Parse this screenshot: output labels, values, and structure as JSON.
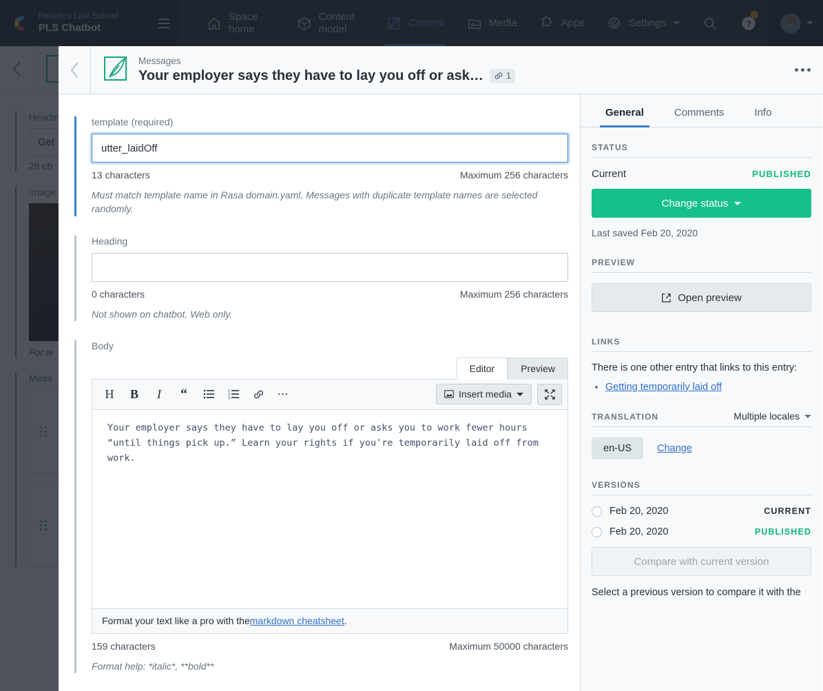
{
  "topnav": {
    "org": "People's Law School",
    "space": "PLS Chatbot",
    "menu_icon": "hamburger-icon",
    "items": [
      {
        "label": "Space home",
        "icon": "home-icon",
        "active": false
      },
      {
        "label": "Content model",
        "icon": "cube-icon",
        "active": false
      },
      {
        "label": "Content",
        "icon": "quill-icon",
        "active": true
      },
      {
        "label": "Media",
        "icon": "media-icon",
        "active": false
      },
      {
        "label": "Apps",
        "icon": "puzzle-icon",
        "active": false
      },
      {
        "label": "Settings",
        "icon": "gear-icon",
        "active": false
      }
    ],
    "search_icon": "search-icon",
    "help_icon": "help-icon",
    "avatar": "avatar"
  },
  "background": {
    "fields": [
      {
        "label": "Heading",
        "value": "Get",
        "count": "28 ch"
      },
      {
        "label": "Image"
      },
      {
        "label": "Mess"
      }
    ],
    "caption": "For w"
  },
  "modal": {
    "back_icon": "chevron-left-icon",
    "entry_icon": "quill-entry-icon",
    "content_type": "Messages",
    "title": "Your employer says they have to lay you off or ask…",
    "link_badge_icon": "link-icon",
    "link_badge_count": "1",
    "more_icon": "ellipsis-icon"
  },
  "editor": {
    "template_field": {
      "label": "template (required)",
      "value": "utter_laidOff",
      "count": "13 characters",
      "max": "Maximum 256 characters",
      "help": "Must match template name in Rasa domain.yaml. Messages with duplicate template names are selected randomly.",
      "focused": true
    },
    "heading_field": {
      "label": "Heading",
      "value": "",
      "placeholder": "",
      "count": "0 characters",
      "max": "Maximum 256 characters",
      "help": "Not shown on chatbot. Web only."
    },
    "body_field": {
      "label": "Body",
      "tabs": [
        {
          "label": "Editor",
          "active": true
        },
        {
          "label": "Preview",
          "active": false
        }
      ],
      "toolbar": [
        {
          "name": "heading-button",
          "glyph": "H"
        },
        {
          "name": "bold-button",
          "glyph": "B"
        },
        {
          "name": "italic-button",
          "glyph": "I"
        },
        {
          "name": "quote-button",
          "glyph": "“"
        },
        {
          "name": "unordered-list-button",
          "glyph": "☰"
        },
        {
          "name": "ordered-list-button",
          "glyph": "☷"
        },
        {
          "name": "link-button",
          "glyph": "⚭"
        },
        {
          "name": "more-options-button",
          "glyph": "⋯"
        }
      ],
      "insert_media_label": "Insert media",
      "insert_media_icon": "image-icon",
      "expand_icon": "expand-icon",
      "value": "Your employer says they have to lay you off or asks you to work fewer hours “until things pick up.” Learn your rights if you're temporarily laid off from work.",
      "footer_prefix": "Format your text like a pro with the ",
      "footer_link": "markdown cheatsheet",
      "footer_suffix": ".",
      "count": "159 characters",
      "max": "Maximum 50000 characters",
      "help": "Format help: *italic*, **bold**"
    }
  },
  "sidebar": {
    "tabs": [
      {
        "label": "General",
        "active": true
      },
      {
        "label": "Comments",
        "active": false
      },
      {
        "label": "Info",
        "active": false
      }
    ],
    "status": {
      "section_title": "STATUS",
      "current_label": "Current",
      "current_value": "PUBLISHED",
      "change_button": "Change status",
      "last_saved": "Last saved Feb 20, 2020"
    },
    "preview": {
      "section_title": "PREVIEW",
      "button_label": "Open preview",
      "button_icon": "external-link-icon"
    },
    "links": {
      "section_title": "LINKS",
      "description": "There is one other entry that links to this entry:",
      "entries": [
        "Getting temporarily laid off"
      ]
    },
    "translation": {
      "section_title": "TRANSLATION",
      "selector_label": "Multiple locales",
      "locale": "en-US",
      "change_label": "Change"
    },
    "versions": {
      "section_title": "VERSIONS",
      "rows": [
        {
          "date": "Feb 20, 2020",
          "tag": "CURRENT",
          "published": false
        },
        {
          "date": "Feb 20, 2020",
          "tag": "PUBLISHED",
          "published": true
        }
      ],
      "compare_button": "Compare with current version",
      "note": "Select a previous version to compare it with the"
    }
  },
  "colors": {
    "accent_blue": "#3c80cf",
    "status_green": "#0eb87f",
    "primary_green": "#17c08b",
    "nav_dark": "#2a3039",
    "link_blue": "#2f6fcb"
  }
}
